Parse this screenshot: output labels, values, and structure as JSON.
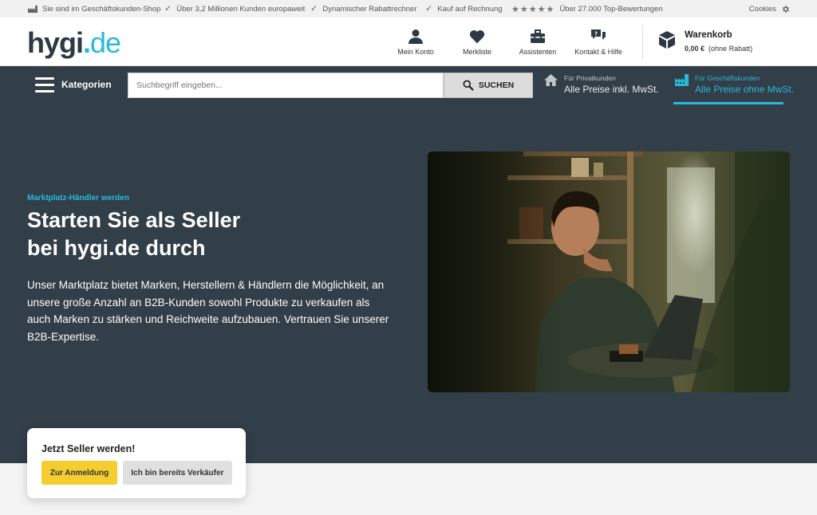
{
  "topbar": {
    "items": [
      "Sie sind im Geschäftskunden-Shop",
      "Über 3,2 Millionen Kunden europaweit",
      "Dynamischer Rabattrechner",
      "Kauf auf Rechnung",
      "Über 27.000 Top-Bewertungen"
    ],
    "cookies": "Cookies"
  },
  "header": {
    "logo": {
      "main": "hygi",
      "dot": ".",
      "tld": "de"
    },
    "nav": [
      {
        "label": "Mein Konto",
        "icon": "user-icon"
      },
      {
        "label": "Merkliste",
        "icon": "heart-icon"
      },
      {
        "label": "Assistenten",
        "icon": "toolbox-icon"
      },
      {
        "label": "Kontakt & Hilfe",
        "icon": "chat-icon"
      }
    ],
    "cart": {
      "title": "Warenkorb",
      "price": "0,00 €",
      "note": "(ohne Rabatt)"
    }
  },
  "navbar": {
    "categories": "Kategorien",
    "search_placeholder": "Suchbegriff eingeben...",
    "search_button": "SUCHEN",
    "private": {
      "small": "Für Privatkunden",
      "big": "Alle Preise inkl. MwSt."
    },
    "business": {
      "small": "Für Geschäftskunden",
      "big": "Alle Preise ohne MwSt."
    }
  },
  "hero": {
    "kicker": "Marktplatz-Händler werden",
    "headline_1": "Starten Sie als Seller",
    "headline_2": "bei hygi.de durch",
    "lead": "Unser Marktplatz bietet Marken, Herstellern & Händlern die Möglichkeit, an unsere große Anzahl an B2B-Kunden sowohl Produkte zu verkaufen als auch Marken zu stärken und Reichweite aufzubauen. Vertrauen Sie unserer B2B-Expertise."
  },
  "seller_box": {
    "title": "Jetzt Seller werden!",
    "primary": "Zur Anmeldung",
    "secondary": "Ich bin bereits Verkäufer"
  },
  "colors": {
    "brand_dark": "#323e48",
    "accent": "#29b9d8",
    "cta_yellow": "#f5cd2f"
  }
}
